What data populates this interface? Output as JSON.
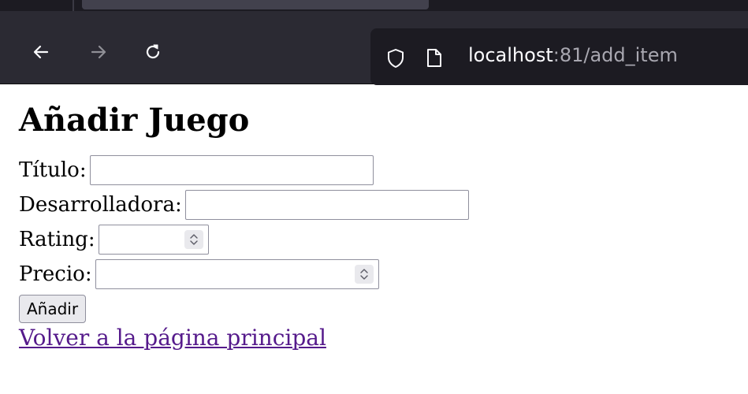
{
  "browser": {
    "url_host": "localhost",
    "url_rest": ":81/add_item"
  },
  "page": {
    "title": "Añadir Juego",
    "fields": {
      "titulo_label": "Título:",
      "titulo_value": "",
      "desarrolladora_label": "Desarrolladora:",
      "desarrolladora_value": "",
      "rating_label": "Rating:",
      "rating_value": "",
      "precio_label": "Precio:",
      "precio_value": ""
    },
    "submit_label": "Añadir",
    "back_link": "Volver a la página principal"
  },
  "colors": {
    "toolbar": "#2b2a33",
    "urlbar": "#1c1b22",
    "link_visited": "#551a8b"
  },
  "icons": {
    "back": "arrow-left-icon",
    "forward": "arrow-right-icon",
    "reload": "reload-icon",
    "tracking": "shield-icon",
    "page": "page-icon"
  }
}
